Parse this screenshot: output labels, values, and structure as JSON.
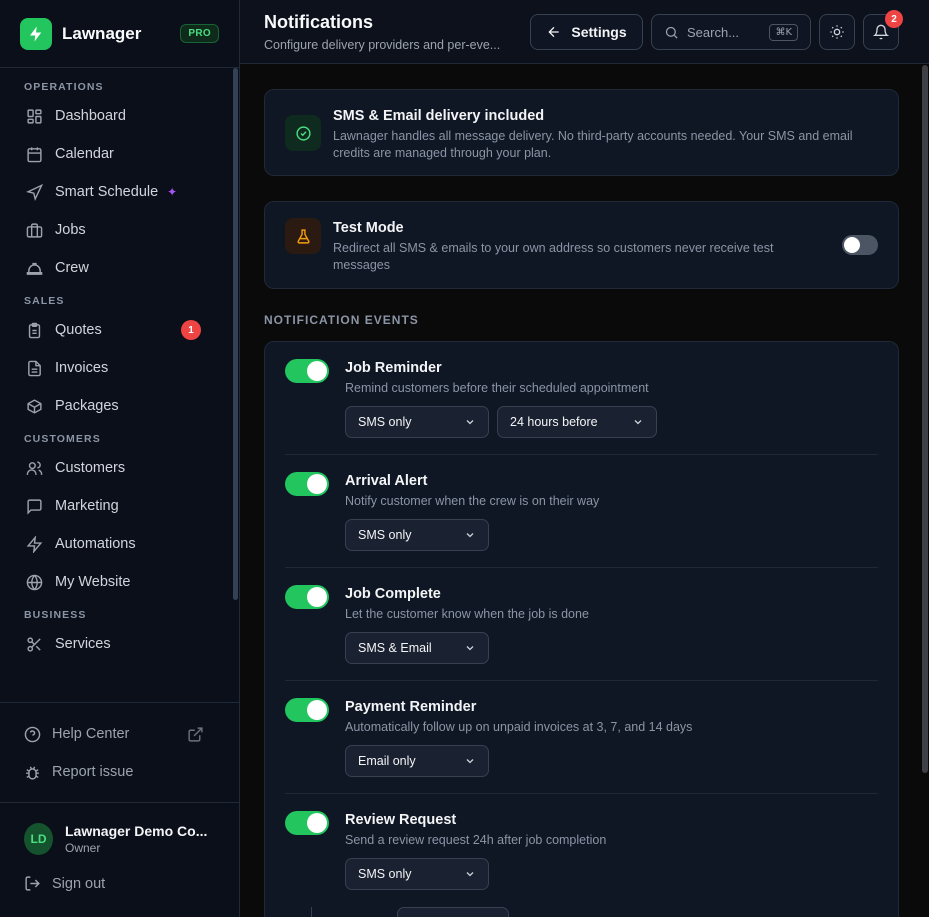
{
  "brand": {
    "name": "Lawnager",
    "badge": "PRO"
  },
  "sidebar": {
    "sections": [
      {
        "label": "OPERATIONS",
        "items": [
          {
            "label": "Dashboard",
            "icon": "dashboard-icon"
          },
          {
            "label": "Calendar",
            "icon": "calendar-icon"
          },
          {
            "label": "Smart Schedule",
            "icon": "navigation-icon",
            "sparkle": "✦"
          },
          {
            "label": "Jobs",
            "icon": "briefcase-icon"
          },
          {
            "label": "Crew",
            "icon": "hardhat-icon"
          }
        ]
      },
      {
        "label": "SALES",
        "items": [
          {
            "label": "Quotes",
            "icon": "clipboard-icon",
            "badge": "1"
          },
          {
            "label": "Invoices",
            "icon": "file-icon"
          },
          {
            "label": "Packages",
            "icon": "package-icon"
          }
        ]
      },
      {
        "label": "CUSTOMERS",
        "items": [
          {
            "label": "Customers",
            "icon": "users-icon"
          },
          {
            "label": "Marketing",
            "icon": "message-icon"
          },
          {
            "label": "Automations",
            "icon": "zap-icon"
          },
          {
            "label": "My Website",
            "icon": "globe-icon"
          }
        ]
      },
      {
        "label": "BUSINESS",
        "items": [
          {
            "label": "Services",
            "icon": "scissors-icon"
          }
        ]
      }
    ],
    "footer": {
      "help": "Help Center",
      "report": "Report issue"
    },
    "user": {
      "initials": "LD",
      "name": "Lawnager Demo Co...",
      "role": "Owner"
    },
    "signout": "Sign out"
  },
  "header": {
    "title": "Notifications",
    "subtitle": "Configure delivery providers and per-eve...",
    "settings_label": "Settings",
    "search_placeholder": "Search...",
    "search_shortcut": "⌘K",
    "notification_count": "2"
  },
  "delivery_card": {
    "title": "SMS & Email delivery included",
    "desc_line1": "Lawnager handles all message delivery. No third-party accounts needed. Your SMS and email",
    "desc_line2": "credits are managed through your plan."
  },
  "test_mode": {
    "title": "Test Mode",
    "desc_line1": "Redirect all SMS & emails to your own address so customers never receive test",
    "desc_line2": "messages",
    "enabled": false
  },
  "events_label": "NOTIFICATION EVENTS",
  "events": [
    {
      "title": "Job Reminder",
      "desc": "Remind customers before their scheduled appointment",
      "enabled": true,
      "channel": "SMS only",
      "timing": "24 hours before"
    },
    {
      "title": "Arrival Alert",
      "desc": "Notify customer when the crew is on their way",
      "enabled": true,
      "channel": "SMS only"
    },
    {
      "title": "Job Complete",
      "desc": "Let the customer know when the job is done",
      "enabled": true,
      "channel": "SMS & Email"
    },
    {
      "title": "Payment Reminder",
      "desc": "Automatically follow up on unpaid invoices at 3, 7, and 14 days",
      "enabled": true,
      "channel": "Email only"
    },
    {
      "title": "Review Request",
      "desc": "Send a review request 24h after job completion",
      "enabled": true,
      "channel": "SMS only"
    }
  ],
  "colors": {
    "accent": "#22c55e",
    "badge": "#ef4444",
    "sparkle": "#a855f7"
  }
}
